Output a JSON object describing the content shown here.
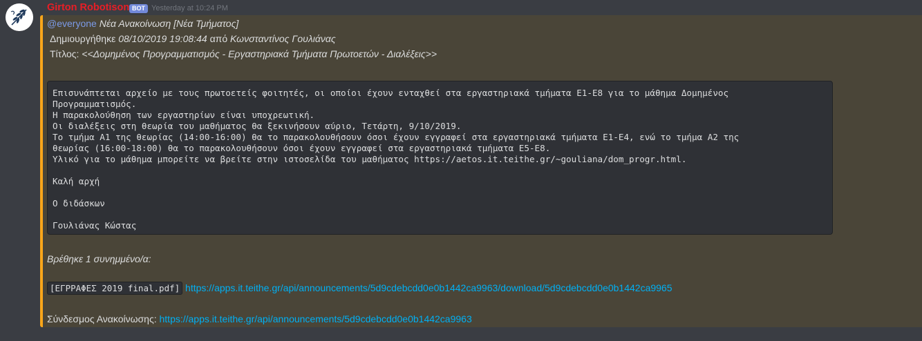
{
  "message": {
    "author": "Girton Robotison",
    "bot_tag": "BOT",
    "timestamp": "Yesterday at 10:24 PM",
    "avatar_icon": "olive-branch-icon"
  },
  "embed": {
    "accent_color": "#faa61a",
    "mention": "@everyone",
    "title": "Νέα Ανακοίνωση [Νέα Τμήματος]",
    "created_prefix": "Δημιουργήθηκε",
    "created_date": "08/10/2019 19:08:44",
    "created_by_word": "από",
    "created_author": "Κωνσταντίνος Γουλιάνας",
    "subject_label": "Τίτλος:",
    "subject_value": "<<Δομημένος Προγραμματισμός - Εργαστηριακά Τμήματα Πρωτοετών - Διαλέξεις>>",
    "body": "Επισυνάπτεται αρχείο με τους πρωτοετείς φοιτητές, οι οποίοι έχουν ενταχθεί στα εργαστηριακά τμήματα Ε1-Ε8 για το μάθημα Δομημένος\nΠρογραμματισμός.\nΗ παρακολούθηση των εργαστηρίων είναι υποχρεωτική.\nΟι διαλέξεις στη θεωρία του μαθήματος θα ξεκινήσουν αύριο, Τετάρτη, 9/10/2019.\nΤο τμήμα Α1 της θεωρίας (14:00-16:00) θα το παρακολουθήσουν όσοι έχουν εγγραφεί στα εργαστηριακά τμήματα Ε1-Ε4, ενώ το τμήμα Α2 της\nθεωρίας (16:00-18:00) θα το παρακολουθήσουν όσοι έχουν εγγραφεί στα εργαστηριακά τμήματα Ε5-Ε8.\nΥλικό για το μάθημα μπορείτε να βρείτε στην ιστοσελίδα του μαθήματος https://aetos.it.teithe.gr/~gouliana/dom_progr.html.\n\nΚαλή αρχή\n\nΟ διδάσκων\n\nΓουλιάνας Κώστας",
    "attachments_found": "Βρέθηκε 1 συνημμένο/α:",
    "attachment_name": "[ΕΓΡΡΑΦΕΣ 2019 final.pdf]",
    "attachment_url": "https://apps.it.teithe.gr/api/announcements/5d9cdebcdd0e0b1442ca9963/download/5d9cdebcdd0e0b1442ca9965",
    "announcement_link_label": "Σύνδεσμος Ανακοίνωσης:",
    "announcement_url": "https://apps.it.teithe.gr/api/announcements/5d9cdebcdd0e0b1442ca9963"
  },
  "actions": {
    "react_icon": "add-reaction-icon",
    "more_icon": "more-options-icon"
  }
}
